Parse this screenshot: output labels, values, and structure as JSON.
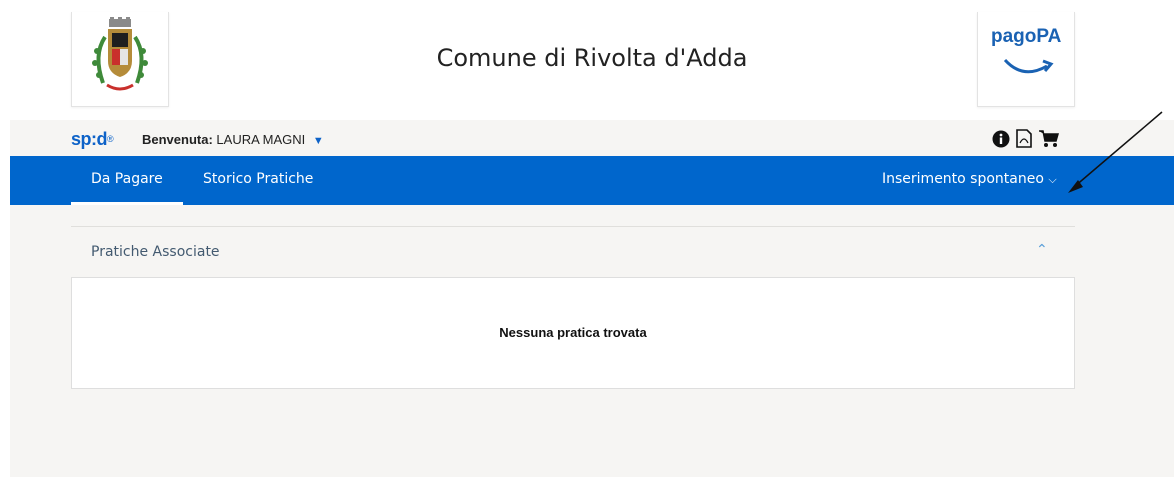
{
  "header": {
    "title": "Comune di Rivolta d'Adda",
    "pagopa_logo": "pagoPA"
  },
  "subbar": {
    "spid_logo": "sp:d",
    "welcome_prefix": "Benvenuta:",
    "user_name": "LAURA MAGNI",
    "icons": [
      "info-icon",
      "pdf-icon",
      "cart-icon"
    ]
  },
  "nav": {
    "tabs": [
      {
        "label": "Da Pagare",
        "active": true
      },
      {
        "label": "Storico Pratiche",
        "active": false
      }
    ],
    "dropdown_label": "Inserimento spontaneo"
  },
  "section": {
    "title": "Pratiche Associate",
    "empty_message": "Nessuna pratica trovata"
  },
  "colors": {
    "nav_blue": "#0066cc",
    "spid_blue": "#0d62c8",
    "background": "#f6f5f3"
  }
}
